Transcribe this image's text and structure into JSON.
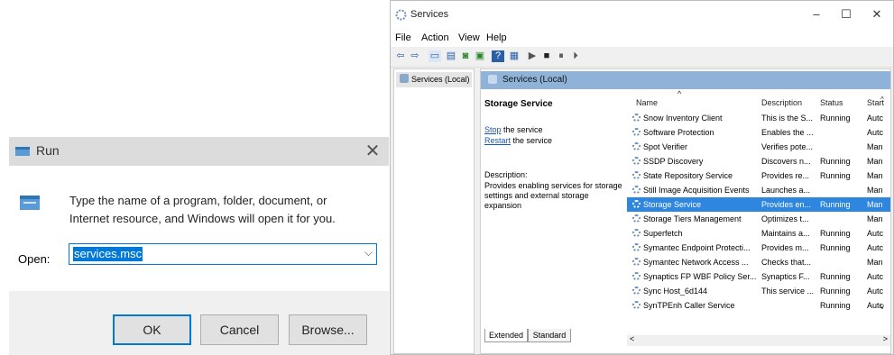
{
  "run": {
    "title": "Run",
    "description": "Type the name of a program, folder, document, or Internet resource, and Windows will open it for you.",
    "open_label": "Open:",
    "input_value": "services.msc",
    "close_glyph": "✕",
    "dropdown_glyph": "⌵",
    "ok_label": "OK",
    "cancel_label": "Cancel",
    "browse_label": "Browse..."
  },
  "services": {
    "title": "Services",
    "controls": {
      "minimize": "–",
      "maximize": "☐",
      "close": "✕"
    },
    "menu": [
      "File",
      "Action",
      "View",
      "Help"
    ],
    "toolbar_icons": [
      "back-arrow-icon",
      "forward-arrow-icon",
      "console-icon",
      "properties-icon",
      "refresh-icon",
      "export-icon",
      "help-icon",
      "view-icon",
      "play-icon",
      "stop-icon",
      "pause-icon",
      "resume-icon"
    ],
    "tree_item": "Services (Local)",
    "header_label": "Services (Local)",
    "detail": {
      "title": "Storage Service",
      "stop_link": "Stop",
      "stop_rest": " the service",
      "restart_link": "Restart",
      "restart_rest": " the service",
      "desc_label": "Description:",
      "desc_text": "Provides enabling services for storage settings and external storage expansion"
    },
    "columns": {
      "name": "Name",
      "description": "Description",
      "status": "Status",
      "startup": "Start"
    },
    "rows": [
      {
        "name": "Snow Inventory Client",
        "description": "This is the S...",
        "status": "Running",
        "startup": "Autc"
      },
      {
        "name": "Software Protection",
        "description": "Enables the ...",
        "status": "",
        "startup": "Autc"
      },
      {
        "name": "Spot Verifier",
        "description": "Verifies pote...",
        "status": "",
        "startup": "Man"
      },
      {
        "name": "SSDP Discovery",
        "description": "Discovers n...",
        "status": "Running",
        "startup": "Man"
      },
      {
        "name": "State Repository Service",
        "description": "Provides re...",
        "status": "Running",
        "startup": "Man"
      },
      {
        "name": "Still Image Acquisition Events",
        "description": "Launches a...",
        "status": "",
        "startup": "Man"
      },
      {
        "name": "Storage Service",
        "description": "Provides en...",
        "status": "Running",
        "startup": "Man",
        "selected": true
      },
      {
        "name": "Storage Tiers Management",
        "description": "Optimizes t...",
        "status": "",
        "startup": "Man"
      },
      {
        "name": "Superfetch",
        "description": "Maintains a...",
        "status": "Running",
        "startup": "Autc"
      },
      {
        "name": "Symantec Endpoint Protecti...",
        "description": "Provides m...",
        "status": "Running",
        "startup": "Autc"
      },
      {
        "name": "Symantec Network Access ...",
        "description": "Checks that...",
        "status": "",
        "startup": "Man"
      },
      {
        "name": "Synaptics FP WBF Policy Ser...",
        "description": "Synaptics F...",
        "status": "Running",
        "startup": "Autc"
      },
      {
        "name": "Sync Host_6d144",
        "description": "This service ...",
        "status": "Running",
        "startup": "Autc"
      },
      {
        "name": "SynTPEnh Caller Service",
        "description": "",
        "status": "Running",
        "startup": "Autc"
      }
    ],
    "tabs": [
      "Extended",
      "Standard"
    ]
  }
}
